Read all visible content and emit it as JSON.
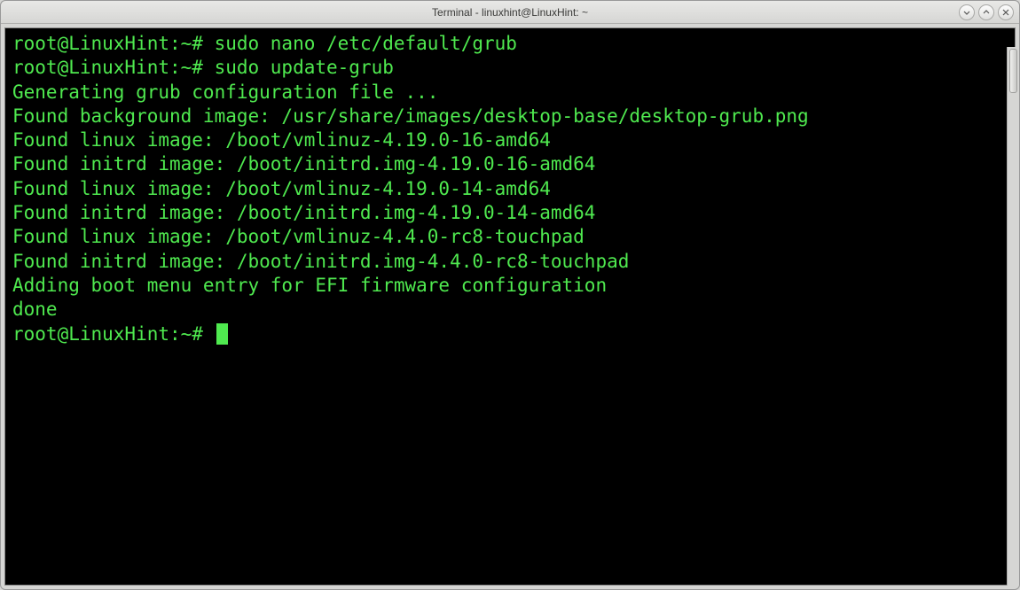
{
  "window": {
    "title": "Terminal - linuxhint@LinuxHint: ~"
  },
  "terminal": {
    "prompt": "root@LinuxHint:~# ",
    "lines": [
      {
        "prompt": "root@LinuxHint:~# ",
        "cmd": "sudo nano /etc/default/grub"
      },
      {
        "prompt": "root@LinuxHint:~# ",
        "cmd": "sudo update-grub"
      },
      {
        "out": "Generating grub configuration file ..."
      },
      {
        "out": "Found background image: /usr/share/images/desktop-base/desktop-grub.png"
      },
      {
        "out": "Found linux image: /boot/vmlinuz-4.19.0-16-amd64"
      },
      {
        "out": "Found initrd image: /boot/initrd.img-4.19.0-16-amd64"
      },
      {
        "out": "Found linux image: /boot/vmlinuz-4.19.0-14-amd64"
      },
      {
        "out": "Found initrd image: /boot/initrd.img-4.19.0-14-amd64"
      },
      {
        "out": "Found linux image: /boot/vmlinuz-4.4.0-rc8-touchpad"
      },
      {
        "out": "Found initrd image: /boot/initrd.img-4.4.0-rc8-touchpad"
      },
      {
        "out": "Adding boot menu entry for EFI firmware configuration"
      },
      {
        "out": "done"
      },
      {
        "prompt": "root@LinuxHint:~# ",
        "cmd": "",
        "cursor": true
      }
    ]
  }
}
